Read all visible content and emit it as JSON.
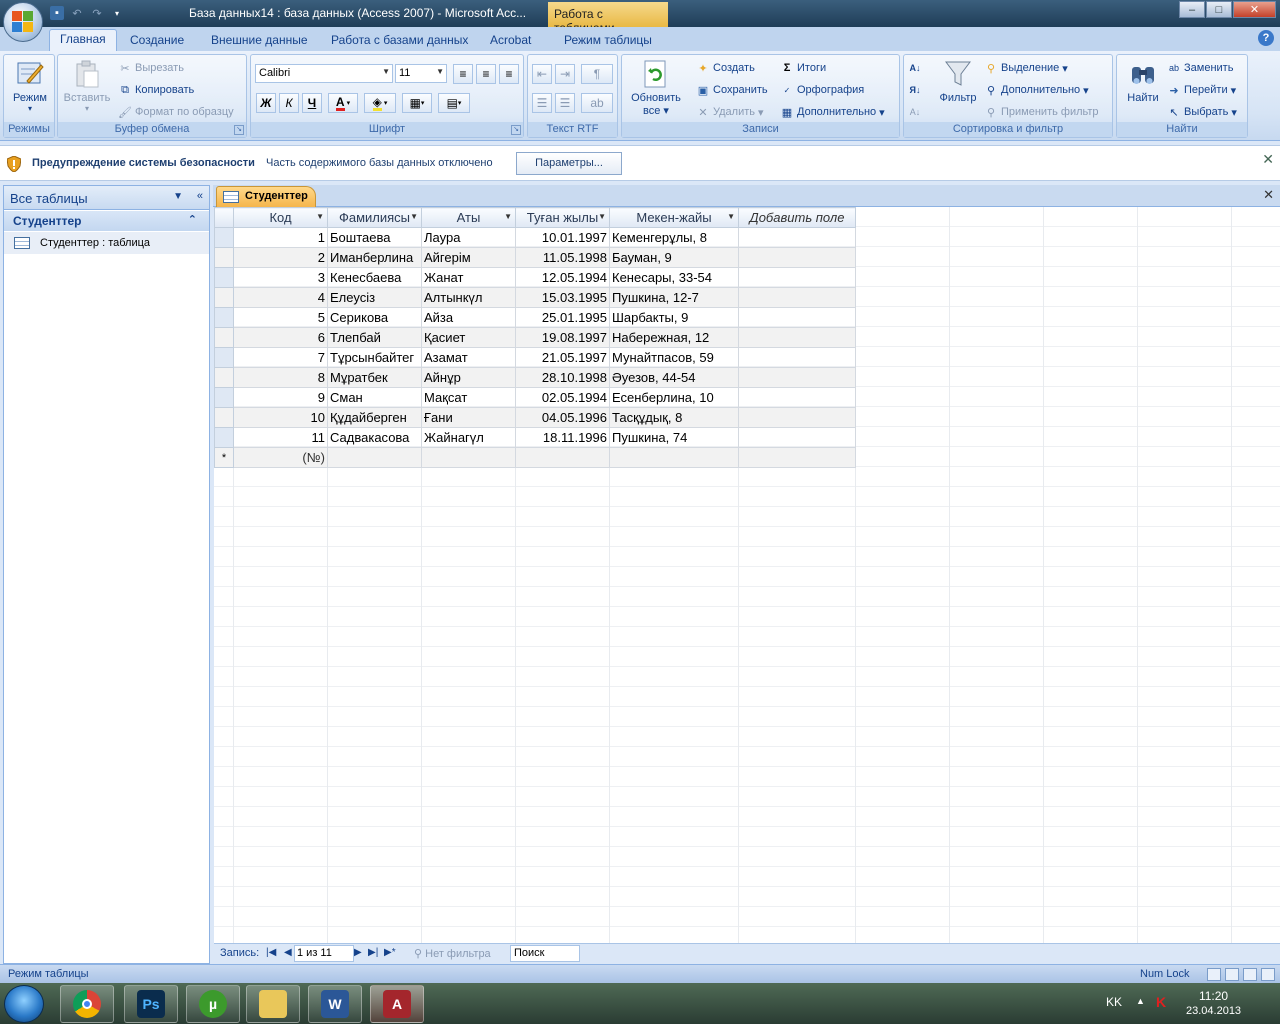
{
  "window": {
    "title": "База данных14 : база данных (Access 2007) - Microsoft Acc...",
    "context_title": "Работа с таблицами",
    "min": "–",
    "max": "□",
    "close": "✕"
  },
  "tabs": [
    "Главная",
    "Создание",
    "Внешние данные",
    "Работа с базами данных",
    "Acrobat",
    "Режим таблицы"
  ],
  "ribbon": {
    "modes": {
      "label": "Режимы",
      "view": "Режим"
    },
    "clipboard": {
      "label": "Буфер обмена",
      "paste": "Вставить",
      "cut": "Вырезать",
      "copy": "Копировать",
      "format_painter": "Формат по образцу"
    },
    "font": {
      "label": "Шрифт",
      "name": "Calibri",
      "size": "11",
      "bold": "Ж",
      "italic": "К",
      "underline": "Ч"
    },
    "rtf": {
      "label": "Текст RTF"
    },
    "records": {
      "label": "Записи",
      "refresh": "Обновить",
      "refresh2": "все",
      "new": "Создать",
      "save": "Сохранить",
      "delete": "Удалить",
      "totals": "Итоги",
      "spelling": "Орфография",
      "more": "Дополнительно"
    },
    "sort": {
      "label": "Сортировка и фильтр",
      "filter": "Фильтр",
      "selection": "Выделение",
      "advanced": "Дополнительно",
      "toggle": "Применить фильтр"
    },
    "find": {
      "label": "Найти",
      "find": "Найти",
      "replace": "Заменить",
      "goto": "Перейти",
      "select": "Выбрать"
    }
  },
  "security": {
    "title": "Предупреждение системы безопасности",
    "message": "Часть содержимого базы данных отключено",
    "button": "Параметры..."
  },
  "nav": {
    "header": "Все таблицы",
    "group": "Студенттер",
    "item": "Студенттер : таблица"
  },
  "document": {
    "tab": "Студенттер"
  },
  "table": {
    "columns": [
      "Код",
      "Фамилиясы",
      "Аты",
      "Туған жылы",
      "Мекен-жайы",
      "Добавить поле"
    ],
    "rows": [
      [
        "1",
        "Боштаева",
        "Лаура",
        "10.01.1997",
        "Кеменгерұлы, 8"
      ],
      [
        "2",
        "Иманберлина",
        "Айгерім",
        "11.05.1998",
        "Бауман, 9"
      ],
      [
        "3",
        "Кенесбаева",
        "Жанат",
        "12.05.1994",
        "Кенесары, 33-54"
      ],
      [
        "4",
        "Елеусіз",
        "Алтынкүл",
        "15.03.1995",
        "Пушкина, 12-7"
      ],
      [
        "5",
        "Серикова",
        "Айза",
        "25.01.1995",
        "Шарбакты, 9"
      ],
      [
        "6",
        "Тлепбай",
        "Қасиет",
        "19.08.1997",
        "Набережная, 12"
      ],
      [
        "7",
        "Тұрсынбайтег",
        "Азамат",
        "21.05.1997",
        "Мунайтпасов, 59"
      ],
      [
        "8",
        "Мұратбек",
        "Айнұр",
        "28.10.1998",
        "Әуезов, 44-54"
      ],
      [
        "9",
        "Сман",
        "Мақсат",
        "02.05.1994",
        "Есенберлина, 10"
      ],
      [
        "10",
        "Құдайберген",
        "Ғани",
        "04.05.1996",
        "Тасқұдық, 8"
      ],
      [
        "11",
        "Садвакасова",
        "Жайнагүл",
        "18.11.1996",
        "Пушкина, 74"
      ]
    ],
    "new_row_marker": "*",
    "new_row_id": "(№)"
  },
  "recnav": {
    "label": "Запись:",
    "counter": "1 из 11",
    "no_filter": "Нет фильтра",
    "search": "Поиск"
  },
  "status": {
    "left": "Режим таблицы",
    "numlock": "Num Lock"
  },
  "taskbar": {
    "lang": "KK",
    "time": "11:20",
    "date": "23.04.2013"
  }
}
